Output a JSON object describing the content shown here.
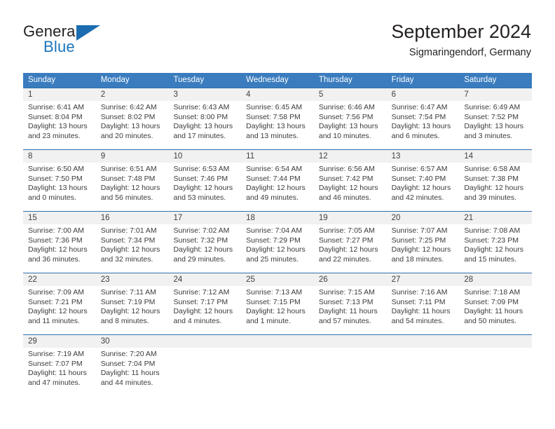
{
  "brand": {
    "name_part1": "General",
    "name_part2": "Blue",
    "triangle_color": "#1b6cb0"
  },
  "header": {
    "month_title": "September 2024",
    "location": "Sigmaringendorf, Germany"
  },
  "colors": {
    "header_blue": "#3a7cbe",
    "week_divider": "#2f6fae",
    "daynum_band": "#f1f1f1",
    "brand_blue": "#1b75bb"
  },
  "weekdays": [
    "Sunday",
    "Monday",
    "Tuesday",
    "Wednesday",
    "Thursday",
    "Friday",
    "Saturday"
  ],
  "weeks": [
    [
      {
        "day": "1",
        "sunrise": "Sunrise: 6:41 AM",
        "sunset": "Sunset: 8:04 PM",
        "daylight1": "Daylight: 13 hours",
        "daylight2": "and 23 minutes."
      },
      {
        "day": "2",
        "sunrise": "Sunrise: 6:42 AM",
        "sunset": "Sunset: 8:02 PM",
        "daylight1": "Daylight: 13 hours",
        "daylight2": "and 20 minutes."
      },
      {
        "day": "3",
        "sunrise": "Sunrise: 6:43 AM",
        "sunset": "Sunset: 8:00 PM",
        "daylight1": "Daylight: 13 hours",
        "daylight2": "and 17 minutes."
      },
      {
        "day": "4",
        "sunrise": "Sunrise: 6:45 AM",
        "sunset": "Sunset: 7:58 PM",
        "daylight1": "Daylight: 13 hours",
        "daylight2": "and 13 minutes."
      },
      {
        "day": "5",
        "sunrise": "Sunrise: 6:46 AM",
        "sunset": "Sunset: 7:56 PM",
        "daylight1": "Daylight: 13 hours",
        "daylight2": "and 10 minutes."
      },
      {
        "day": "6",
        "sunrise": "Sunrise: 6:47 AM",
        "sunset": "Sunset: 7:54 PM",
        "daylight1": "Daylight: 13 hours",
        "daylight2": "and 6 minutes."
      },
      {
        "day": "7",
        "sunrise": "Sunrise: 6:49 AM",
        "sunset": "Sunset: 7:52 PM",
        "daylight1": "Daylight: 13 hours",
        "daylight2": "and 3 minutes."
      }
    ],
    [
      {
        "day": "8",
        "sunrise": "Sunrise: 6:50 AM",
        "sunset": "Sunset: 7:50 PM",
        "daylight1": "Daylight: 13 hours",
        "daylight2": "and 0 minutes."
      },
      {
        "day": "9",
        "sunrise": "Sunrise: 6:51 AM",
        "sunset": "Sunset: 7:48 PM",
        "daylight1": "Daylight: 12 hours",
        "daylight2": "and 56 minutes."
      },
      {
        "day": "10",
        "sunrise": "Sunrise: 6:53 AM",
        "sunset": "Sunset: 7:46 PM",
        "daylight1": "Daylight: 12 hours",
        "daylight2": "and 53 minutes."
      },
      {
        "day": "11",
        "sunrise": "Sunrise: 6:54 AM",
        "sunset": "Sunset: 7:44 PM",
        "daylight1": "Daylight: 12 hours",
        "daylight2": "and 49 minutes."
      },
      {
        "day": "12",
        "sunrise": "Sunrise: 6:56 AM",
        "sunset": "Sunset: 7:42 PM",
        "daylight1": "Daylight: 12 hours",
        "daylight2": "and 46 minutes."
      },
      {
        "day": "13",
        "sunrise": "Sunrise: 6:57 AM",
        "sunset": "Sunset: 7:40 PM",
        "daylight1": "Daylight: 12 hours",
        "daylight2": "and 42 minutes."
      },
      {
        "day": "14",
        "sunrise": "Sunrise: 6:58 AM",
        "sunset": "Sunset: 7:38 PM",
        "daylight1": "Daylight: 12 hours",
        "daylight2": "and 39 minutes."
      }
    ],
    [
      {
        "day": "15",
        "sunrise": "Sunrise: 7:00 AM",
        "sunset": "Sunset: 7:36 PM",
        "daylight1": "Daylight: 12 hours",
        "daylight2": "and 36 minutes."
      },
      {
        "day": "16",
        "sunrise": "Sunrise: 7:01 AM",
        "sunset": "Sunset: 7:34 PM",
        "daylight1": "Daylight: 12 hours",
        "daylight2": "and 32 minutes."
      },
      {
        "day": "17",
        "sunrise": "Sunrise: 7:02 AM",
        "sunset": "Sunset: 7:32 PM",
        "daylight1": "Daylight: 12 hours",
        "daylight2": "and 29 minutes."
      },
      {
        "day": "18",
        "sunrise": "Sunrise: 7:04 AM",
        "sunset": "Sunset: 7:29 PM",
        "daylight1": "Daylight: 12 hours",
        "daylight2": "and 25 minutes."
      },
      {
        "day": "19",
        "sunrise": "Sunrise: 7:05 AM",
        "sunset": "Sunset: 7:27 PM",
        "daylight1": "Daylight: 12 hours",
        "daylight2": "and 22 minutes."
      },
      {
        "day": "20",
        "sunrise": "Sunrise: 7:07 AM",
        "sunset": "Sunset: 7:25 PM",
        "daylight1": "Daylight: 12 hours",
        "daylight2": "and 18 minutes."
      },
      {
        "day": "21",
        "sunrise": "Sunrise: 7:08 AM",
        "sunset": "Sunset: 7:23 PM",
        "daylight1": "Daylight: 12 hours",
        "daylight2": "and 15 minutes."
      }
    ],
    [
      {
        "day": "22",
        "sunrise": "Sunrise: 7:09 AM",
        "sunset": "Sunset: 7:21 PM",
        "daylight1": "Daylight: 12 hours",
        "daylight2": "and 11 minutes."
      },
      {
        "day": "23",
        "sunrise": "Sunrise: 7:11 AM",
        "sunset": "Sunset: 7:19 PM",
        "daylight1": "Daylight: 12 hours",
        "daylight2": "and 8 minutes."
      },
      {
        "day": "24",
        "sunrise": "Sunrise: 7:12 AM",
        "sunset": "Sunset: 7:17 PM",
        "daylight1": "Daylight: 12 hours",
        "daylight2": "and 4 minutes."
      },
      {
        "day": "25",
        "sunrise": "Sunrise: 7:13 AM",
        "sunset": "Sunset: 7:15 PM",
        "daylight1": "Daylight: 12 hours",
        "daylight2": "and 1 minute."
      },
      {
        "day": "26",
        "sunrise": "Sunrise: 7:15 AM",
        "sunset": "Sunset: 7:13 PM",
        "daylight1": "Daylight: 11 hours",
        "daylight2": "and 57 minutes."
      },
      {
        "day": "27",
        "sunrise": "Sunrise: 7:16 AM",
        "sunset": "Sunset: 7:11 PM",
        "daylight1": "Daylight: 11 hours",
        "daylight2": "and 54 minutes."
      },
      {
        "day": "28",
        "sunrise": "Sunrise: 7:18 AM",
        "sunset": "Sunset: 7:09 PM",
        "daylight1": "Daylight: 11 hours",
        "daylight2": "and 50 minutes."
      }
    ],
    [
      {
        "day": "29",
        "sunrise": "Sunrise: 7:19 AM",
        "sunset": "Sunset: 7:07 PM",
        "daylight1": "Daylight: 11 hours",
        "daylight2": "and 47 minutes."
      },
      {
        "day": "30",
        "sunrise": "Sunrise: 7:20 AM",
        "sunset": "Sunset: 7:04 PM",
        "daylight1": "Daylight: 11 hours",
        "daylight2": "and 44 minutes."
      },
      {
        "day": "",
        "sunrise": "",
        "sunset": "",
        "daylight1": "",
        "daylight2": ""
      },
      {
        "day": "",
        "sunrise": "",
        "sunset": "",
        "daylight1": "",
        "daylight2": ""
      },
      {
        "day": "",
        "sunrise": "",
        "sunset": "",
        "daylight1": "",
        "daylight2": ""
      },
      {
        "day": "",
        "sunrise": "",
        "sunset": "",
        "daylight1": "",
        "daylight2": ""
      },
      {
        "day": "",
        "sunrise": "",
        "sunset": "",
        "daylight1": "",
        "daylight2": ""
      }
    ]
  ]
}
